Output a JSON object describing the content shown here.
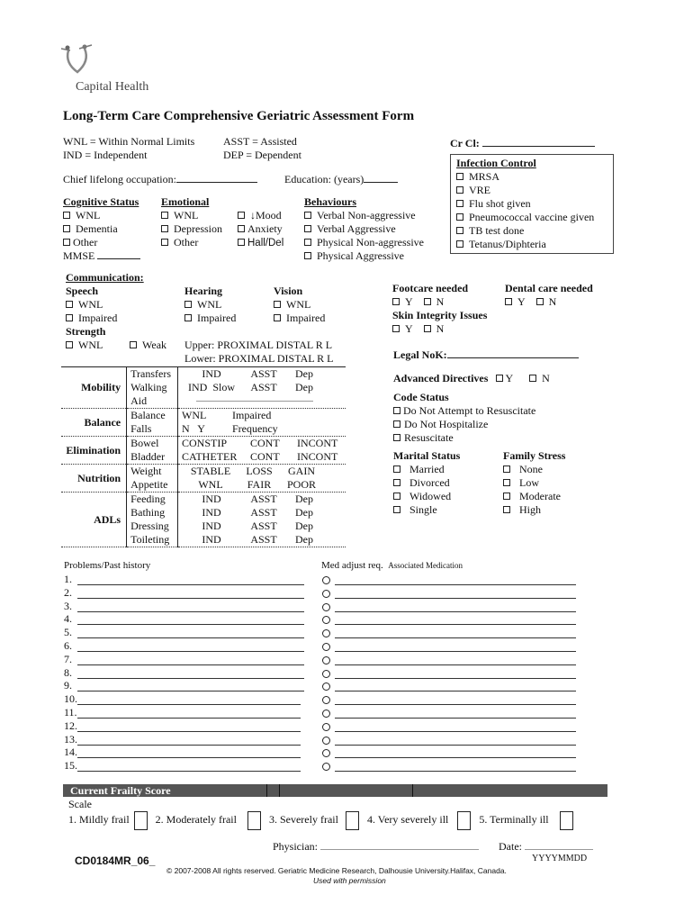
{
  "header": {
    "org": "Capital Health",
    "title": "Long-Term Care Comprehensive Geriatric Assessment Form",
    "legend": [
      "WNL = Within Normal Limits",
      "IND  = Independent",
      "ASST = Assisted",
      "DEP  = Dependent"
    ],
    "crcl_label": "Cr Cl:",
    "occupation_label": "Chief lifelong occupation:",
    "education_label": "Education: (years)"
  },
  "infection_control": {
    "title": "Infection Control",
    "items": [
      "MRSA",
      "VRE",
      "Flu shot  given",
      "Pneumococcal vaccine given",
      "TB test done",
      "Tetanus/Diphteria"
    ]
  },
  "cognitive": {
    "title": "Cognitive Status",
    "items": [
      "WNL",
      "Dementia",
      "Other"
    ],
    "mmse_label": "MMSE"
  },
  "emotional": {
    "title": "Emotional",
    "col1": [
      "WNL",
      "Depression",
      "Other"
    ],
    "col2": [
      "↓Mood",
      "Anxiety",
      "Hall/Del"
    ]
  },
  "behaviours": {
    "title": "Behaviours",
    "items": [
      "Verbal Non-aggressive",
      "Verbal  Aggressive",
      "Physical Non-aggressive",
      "Physical Aggressive"
    ]
  },
  "communication": {
    "title": "Communication:",
    "speech": {
      "title": "Speech",
      "items": [
        "WNL",
        "Impaired"
      ]
    },
    "hearing": {
      "title": "Hearing",
      "items": [
        "WNL",
        "Impaired"
      ]
    },
    "vision": {
      "title": "Vision",
      "items": [
        "WNL",
        "Impaired"
      ]
    },
    "strength": {
      "title": "Strength",
      "items": [
        "WNL",
        "Weak"
      ],
      "upper": "Upper:  PROXIMAL DISTAL  R  L",
      "lower": "Lower:  PROXIMAL DISTAL  R  L"
    }
  },
  "care": {
    "footcare": {
      "title": "Footcare needed",
      "y": "Y",
      "n": "N"
    },
    "dental": {
      "title": "Dental care needed",
      "y": "Y",
      "n": "N"
    },
    "skin": {
      "title": "Skin Integrity Issues",
      "y": "Y",
      "n": "N"
    },
    "nok_label": "Legal NoK:",
    "directives": {
      "title": "Advanced Directives",
      "y": "Y",
      "n": "N"
    }
  },
  "code_status": {
    "title": "Code Status",
    "items": [
      "Do Not Attempt to Resuscitate",
      "Do Not Hospitalize",
      "Resuscitate"
    ]
  },
  "marital": {
    "title": "Marital Status",
    "items": [
      "Married",
      "Divorced",
      "Widowed",
      "Single"
    ]
  },
  "family_stress": {
    "title": "Family Stress",
    "items": [
      "None",
      "Low",
      "Moderate",
      "High"
    ]
  },
  "assessment": {
    "mobility": {
      "label": "Mobility",
      "rows": [
        [
          "Transfers",
          "IND",
          "ASST",
          "Dep"
        ],
        [
          "Walking",
          "IND  Slow",
          "ASST",
          "Dep"
        ],
        [
          "Aid",
          "",
          "",
          ""
        ]
      ]
    },
    "balance": {
      "label": "Balance",
      "rows": [
        [
          "Balance",
          "WNL",
          "Impaired",
          ""
        ],
        [
          "Falls",
          "N   Y",
          "Frequency",
          ""
        ]
      ]
    },
    "elimination": {
      "label": "Elimination",
      "rows": [
        [
          "Bowel",
          "CONSTIP",
          "CONT",
          "INCONT"
        ],
        [
          "Bladder",
          "CATHETER",
          "CONT",
          "INCONT"
        ]
      ]
    },
    "nutrition": {
      "label": "Nutrition",
      "rows": [
        [
          "Weight",
          "STABLE",
          "LOSS",
          "GAIN"
        ],
        [
          "Appetite",
          "WNL",
          "FAIR",
          "POOR"
        ]
      ]
    },
    "adls": {
      "label": "ADLs",
      "rows": [
        [
          "Feeding",
          "IND",
          "ASST",
          "Dep"
        ],
        [
          "Bathing",
          "IND",
          "ASST",
          "Dep"
        ],
        [
          "Dressing",
          "IND",
          "ASST",
          "Dep"
        ],
        [
          "Toileting",
          "IND",
          "ASST",
          "Dep"
        ]
      ]
    }
  },
  "problems": {
    "title": "Problems/Past history",
    "med_title": "Med adjust req.",
    "med_subtitle": "Associated Medication",
    "numbers": [
      "1.",
      "2.",
      "3.",
      "4.",
      "5.",
      "6.",
      "7.",
      "8.",
      "9.",
      "10.",
      "11.",
      "12.",
      "13.",
      "14.",
      "15."
    ]
  },
  "frailty": {
    "title": "Current Frailty Score",
    "scale_label": "Scale",
    "options": [
      "1. Mildly frail",
      "2. Moderately frail",
      "3. Severely frail",
      "4. Very severely ill",
      "5. Terminally ill"
    ]
  },
  "footer": {
    "physician_label": "Physician:",
    "date_label": "Date:",
    "date_format": "YYYYMMDD",
    "form_code": "CD0184MR_06_",
    "copyright": "© 2007-2008 All rights reserved. Geriatric Medicine Research, Dalhousie University.Halifax, Canada.",
    "permission": "Used with permission"
  }
}
